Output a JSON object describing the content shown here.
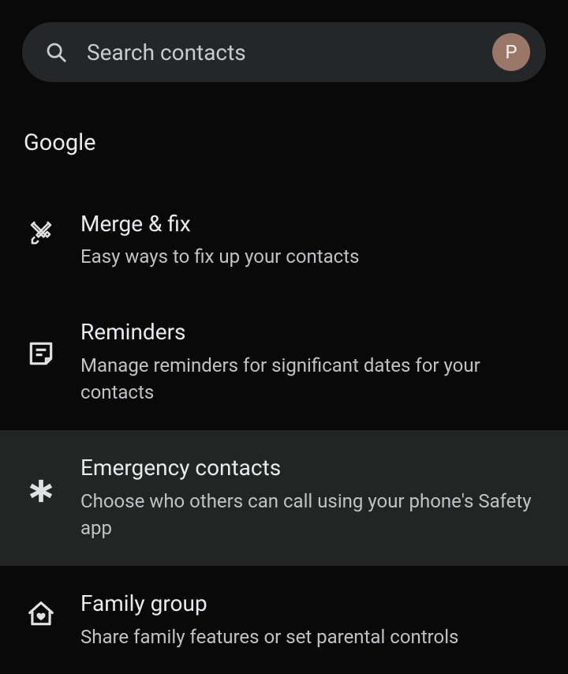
{
  "search": {
    "placeholder": "Search contacts"
  },
  "profile": {
    "initial": "P"
  },
  "section": {
    "header": "Google"
  },
  "items": [
    {
      "icon": "tools-icon",
      "title": "Merge & fix",
      "subtitle": "Easy ways to fix up your contacts",
      "highlighted": false
    },
    {
      "icon": "note-icon",
      "title": "Reminders",
      "subtitle": "Manage reminders for significant dates for your contacts",
      "highlighted": false
    },
    {
      "icon": "asterisk-icon",
      "title": "Emergency contacts",
      "subtitle": "Choose who others can call using your phone's Safety app",
      "highlighted": true
    },
    {
      "icon": "home-heart-icon",
      "title": "Family group",
      "subtitle": "Share family features or set parental controls",
      "highlighted": false
    }
  ]
}
